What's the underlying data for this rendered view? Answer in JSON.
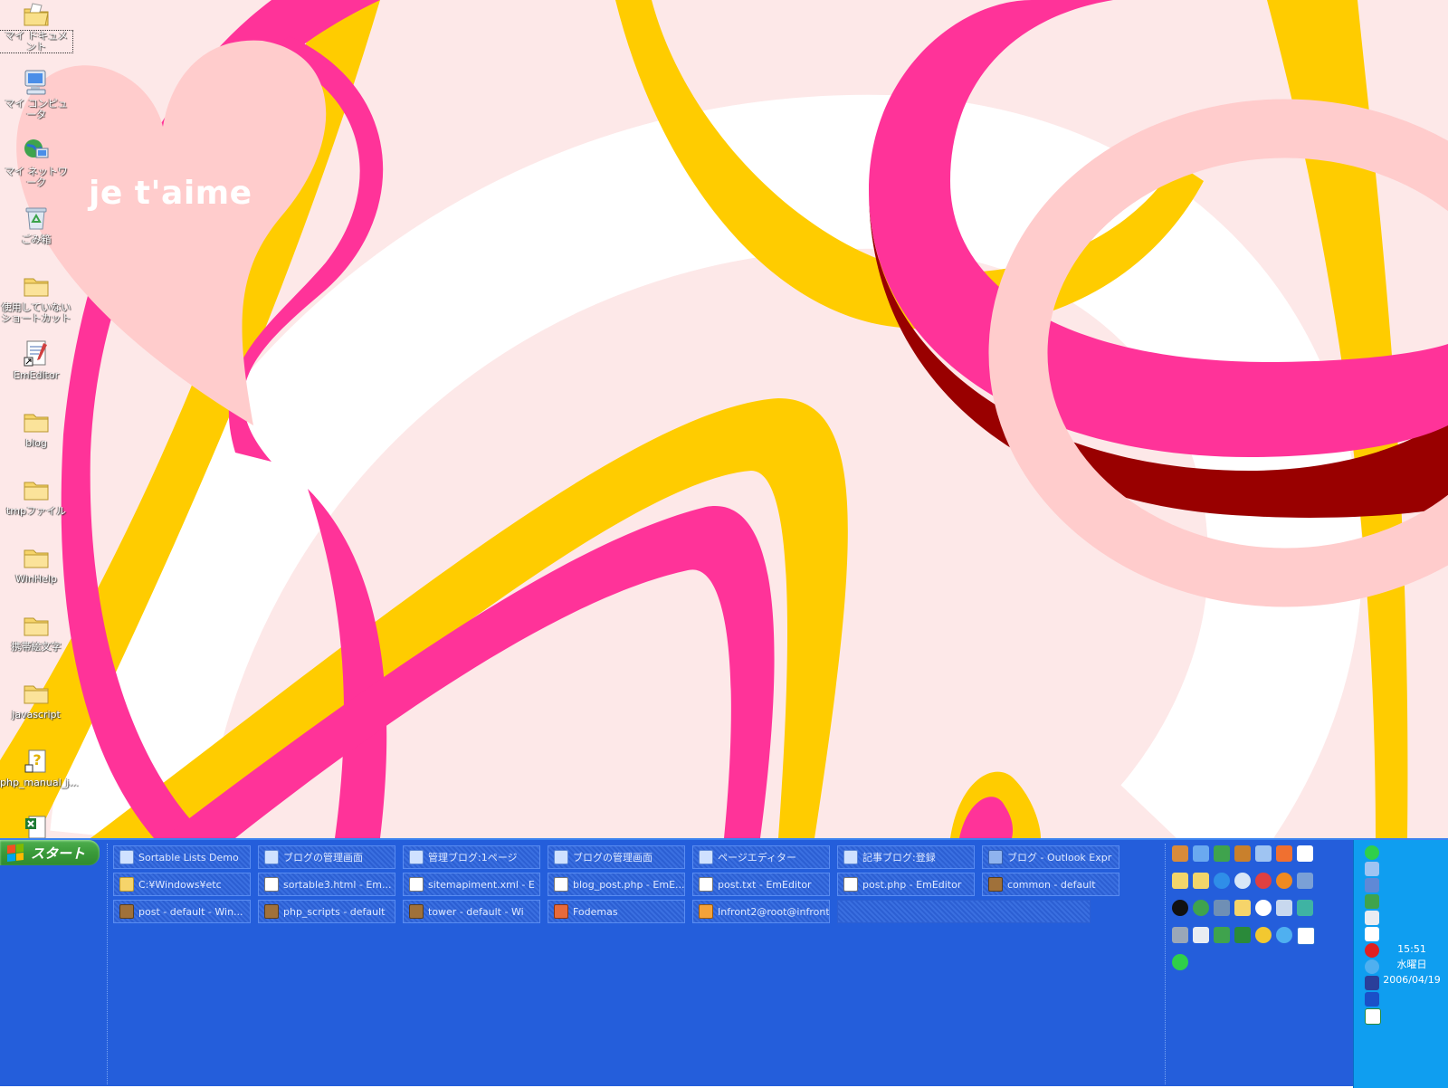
{
  "wallpaper": {
    "text": "je t'aime"
  },
  "desktop_icons": [
    {
      "label": "マイ ドキュメント",
      "icon": "my-documents-icon",
      "selected": true
    },
    {
      "label": "マイ コンピュータ",
      "icon": "my-computer-icon"
    },
    {
      "label": "マイ ネットワーク",
      "icon": "my-network-icon"
    },
    {
      "label": "ごみ箱",
      "icon": "recycle-bin-icon"
    },
    {
      "label": "使用していない ショートカット",
      "icon": "folder-icon"
    },
    {
      "label": "EmEditor",
      "icon": "emeditor-shortcut-icon"
    },
    {
      "label": "blog",
      "icon": "folder-icon"
    },
    {
      "label": "tmpファイル",
      "icon": "folder-icon"
    },
    {
      "label": "WinHelp",
      "icon": "folder-icon"
    },
    {
      "label": "携帯絵文字",
      "icon": "folder-icon"
    },
    {
      "label": "javascript",
      "icon": "folder-icon"
    },
    {
      "label": "php_manual_j...",
      "icon": "help-file-icon"
    },
    {
      "label": "",
      "icon": "excel-file-icon"
    }
  ],
  "taskbar": {
    "start_label": "スタート",
    "tasks": [
      {
        "label": "Sortable Lists Demo",
        "icon": "ie-page-icon"
      },
      {
        "label": "ブログの管理画面",
        "icon": "ie-page-icon"
      },
      {
        "label": "管理ブログ:1ページ",
        "icon": "ie-page-icon"
      },
      {
        "label": "ブログの管理画面",
        "icon": "ie-page-icon"
      },
      {
        "label": "ページエディター",
        "icon": "ie-page-icon"
      },
      {
        "label": "記事ブログ:登録",
        "icon": "ie-page-icon"
      },
      {
        "label": "ブログ - Outlook Expr",
        "icon": "outlook-icon"
      },
      {
        "label": "C:¥Windows¥etc",
        "icon": "folder-icon"
      },
      {
        "label": "sortable3.html - Em...",
        "icon": "emeditor-icon"
      },
      {
        "label": "sitemapiment.xml - E",
        "icon": "emeditor-icon"
      },
      {
        "label": "blog_post.php - EmE...",
        "icon": "emeditor-icon"
      },
      {
        "label": "post.txt - EmEditor",
        "icon": "emeditor-icon"
      },
      {
        "label": "post.php - EmEditor",
        "icon": "emeditor-icon"
      },
      {
        "label": "common - default",
        "icon": "terminal-icon"
      },
      {
        "label": "post - default - Win...",
        "icon": "terminal-icon"
      },
      {
        "label": "php_scripts - default",
        "icon": "terminal-icon"
      },
      {
        "label": "tower - default - Wi",
        "icon": "terminal-icon"
      },
      {
        "label": "Fodemas",
        "icon": "app-icon"
      },
      {
        "label": "Infront2@root@infront2",
        "icon": "ssh-icon"
      }
    ],
    "quick_launch": [
      "people-icon",
      "ie-icon",
      "network-icon",
      "tool-icon",
      "bucket-icon",
      "star-icon",
      "notepad-icon",
      "help-icon",
      "help2-icon",
      "ie-blue-icon",
      "media-icon",
      "disc-icon",
      "firefox-icon",
      "network2-icon",
      "dark-circle-icon",
      "refresh-icon",
      "shield-icon",
      "folder-icon",
      "media-player-icon",
      "drive-icon",
      "calculator-icon",
      "info-icon",
      "window-icon",
      "chart-icon",
      "triangle-icon",
      "mascot-icon",
      "search-icon",
      "vp-icon",
      "n-green-icon"
    ],
    "tray_icons": [
      "n-green-icon",
      "person-icon",
      "monitor-icon",
      "exchange-icon",
      "pen-icon",
      "notepad-icon",
      "adobe-icon",
      "magnifier-icon",
      "book-icon",
      "play-icon",
      "vp-icon"
    ],
    "clock": {
      "time": "15:51",
      "weekday": "水曜日",
      "date": "2006/04/19"
    }
  },
  "colors": {
    "taskbar": "#245edb",
    "tray": "#0f9ef0",
    "start": "#3a9a3a",
    "wallpaper_pink": "#ff3399",
    "wallpaper_yellow": "#ffcc00",
    "wallpaper_light": "#fde8e8",
    "wallpaper_dark_red": "#990000"
  }
}
